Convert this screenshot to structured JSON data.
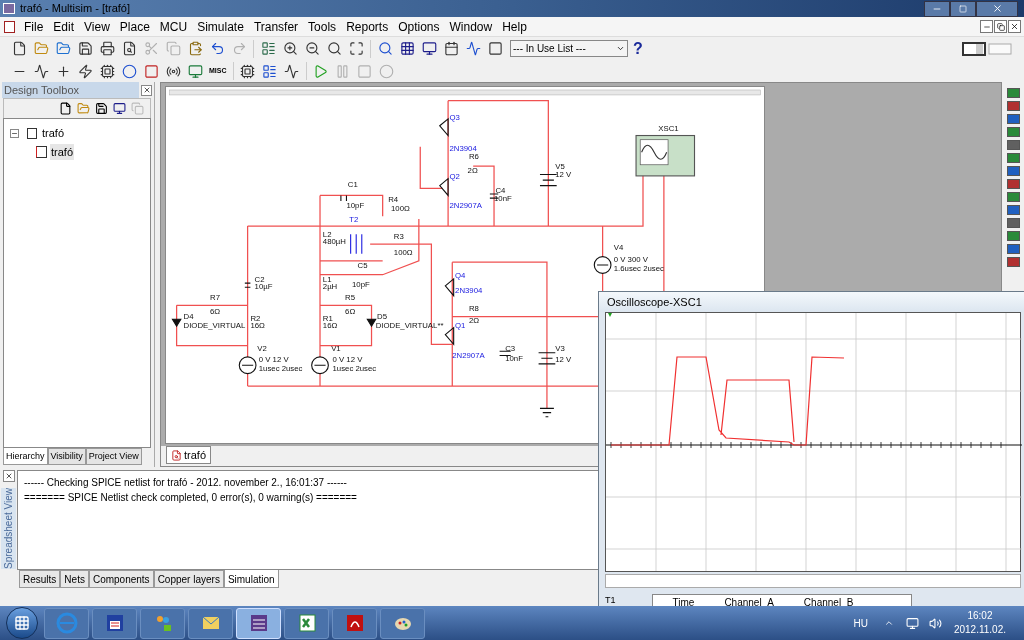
{
  "window": {
    "title": "trafó - Multisim - [trafó]"
  },
  "menu": [
    {
      "label": "File"
    },
    {
      "label": "Edit"
    },
    {
      "label": "View"
    },
    {
      "label": "Place"
    },
    {
      "label": "MCU"
    },
    {
      "label": "Simulate"
    },
    {
      "label": "Transfer"
    },
    {
      "label": "Tools"
    },
    {
      "label": "Reports"
    },
    {
      "label": "Options"
    },
    {
      "label": "Window"
    },
    {
      "label": "Help"
    }
  ],
  "toolbar": {
    "misc_label": "MISC",
    "in_use_list": {
      "value": "--- In Use List ---"
    },
    "help": "?"
  },
  "design_toolbox": {
    "title": "Design Toolbox",
    "tree": [
      {
        "label": "trafó",
        "expanded": true,
        "children": [
          {
            "label": "trafó",
            "selected": true
          }
        ]
      }
    ],
    "tabs": [
      {
        "label": "Hierarchy",
        "selected": true
      },
      {
        "label": "Visibility",
        "selected": false
      },
      {
        "label": "Project View",
        "selected": false
      }
    ]
  },
  "schematic": {
    "labels": [
      {
        "text": "Q3",
        "kind": "transistor"
      },
      {
        "text": "2N3904",
        "kind": "transistor"
      },
      {
        "text": "R6",
        "kind": "part"
      },
      {
        "text": "2Ω",
        "kind": "part"
      },
      {
        "text": "Q2",
        "kind": "transistor"
      },
      {
        "text": "2N2907A",
        "kind": "transistor"
      },
      {
        "text": "C4",
        "kind": "part"
      },
      {
        "text": "10nF",
        "kind": "part"
      },
      {
        "text": "V5",
        "kind": "part"
      },
      {
        "text": "12 V",
        "kind": "part"
      },
      {
        "text": "XSC1",
        "kind": "part"
      },
      {
        "text": "C1",
        "kind": "part"
      },
      {
        "text": "10pF",
        "kind": "part"
      },
      {
        "text": "R4",
        "kind": "part"
      },
      {
        "text": "100Ω",
        "kind": "part"
      },
      {
        "text": "T2",
        "kind": "transistor"
      },
      {
        "text": "L2",
        "kind": "part"
      },
      {
        "text": "480µH",
        "kind": "part"
      },
      {
        "text": "R3",
        "kind": "part"
      },
      {
        "text": "100Ω",
        "kind": "part"
      },
      {
        "text": "C5",
        "kind": "part"
      },
      {
        "text": "10pF",
        "kind": "part"
      },
      {
        "text": "L1",
        "kind": "part"
      },
      {
        "text": "2µH",
        "kind": "part"
      },
      {
        "text": "C2",
        "kind": "part"
      },
      {
        "text": "10µF",
        "kind": "part"
      },
      {
        "text": "R7",
        "kind": "part"
      },
      {
        "text": "6Ω",
        "kind": "part"
      },
      {
        "text": "R2",
        "kind": "part"
      },
      {
        "text": "16Ω",
        "kind": "part"
      },
      {
        "text": "D4",
        "kind": "part"
      },
      {
        "text": "DIODE_VIRTUAL",
        "kind": "part"
      },
      {
        "text": "R5",
        "kind": "part"
      },
      {
        "text": "6Ω",
        "kind": "part"
      },
      {
        "text": "D5",
        "kind": "part"
      },
      {
        "text": "DIODE_VIRTUAL**",
        "kind": "part"
      },
      {
        "text": "R1",
        "kind": "part"
      },
      {
        "text": "16Ω",
        "kind": "part"
      },
      {
        "text": "V2",
        "kind": "part"
      },
      {
        "text": "0 V 12 V",
        "kind": "part"
      },
      {
        "text": "1usec 2usec",
        "kind": "part"
      },
      {
        "text": "V1",
        "kind": "part"
      },
      {
        "text": "0 V 12 V",
        "kind": "part"
      },
      {
        "text": "1usec 2usec",
        "kind": "part"
      },
      {
        "text": "Q4",
        "kind": "transistor"
      },
      {
        "text": "2N3904",
        "kind": "transistor"
      },
      {
        "text": "R8",
        "kind": "part"
      },
      {
        "text": "2Ω",
        "kind": "part"
      },
      {
        "text": "Q1",
        "kind": "transistor"
      },
      {
        "text": "2N2907A",
        "kind": "transistor"
      },
      {
        "text": "C3",
        "kind": "part"
      },
      {
        "text": "10nF",
        "kind": "part"
      },
      {
        "text": "V3",
        "kind": "part"
      },
      {
        "text": "12 V",
        "kind": "part"
      },
      {
        "text": "V4",
        "kind": "part"
      },
      {
        "text": "0 V 300 V",
        "kind": "part"
      },
      {
        "text": "1.6usec 2usec",
        "kind": "part"
      }
    ]
  },
  "sheet_tabs": [
    {
      "label": "trafó",
      "selected": true
    }
  ],
  "spreadsheet": {
    "side_label": "Spreadsheet View",
    "log": [
      "------ Checking SPICE netlist for trafó - 2012. november 2., 16:01:37 ------",
      "======= SPICE Netlist check completed, 0 error(s), 0 warning(s) ======="
    ],
    "tabs": [
      {
        "label": "Results",
        "selected": false
      },
      {
        "label": "Nets",
        "selected": false
      },
      {
        "label": "Components",
        "selected": false
      },
      {
        "label": "Copper layers",
        "selected": false
      },
      {
        "label": "Simulation",
        "selected": true
      }
    ]
  },
  "oscilloscope": {
    "title": "Oscilloscope-XSC1",
    "cursor_label": "T1",
    "table_columns": [
      "Time",
      "Channel_A",
      "Channel_B"
    ]
  },
  "taskbar": {
    "apps": [
      {
        "kind": "browser",
        "selected": false
      },
      {
        "kind": "floppy",
        "selected": false
      },
      {
        "kind": "people",
        "selected": false
      },
      {
        "kind": "mail",
        "selected": false
      },
      {
        "kind": "multisim",
        "selected": true
      },
      {
        "kind": "spreadsheet",
        "selected": false
      },
      {
        "kind": "pdf",
        "selected": false
      },
      {
        "kind": "paint",
        "selected": false
      }
    ],
    "tray": {
      "language": "HU",
      "time": "16:02",
      "date": "2012.11.02."
    }
  }
}
